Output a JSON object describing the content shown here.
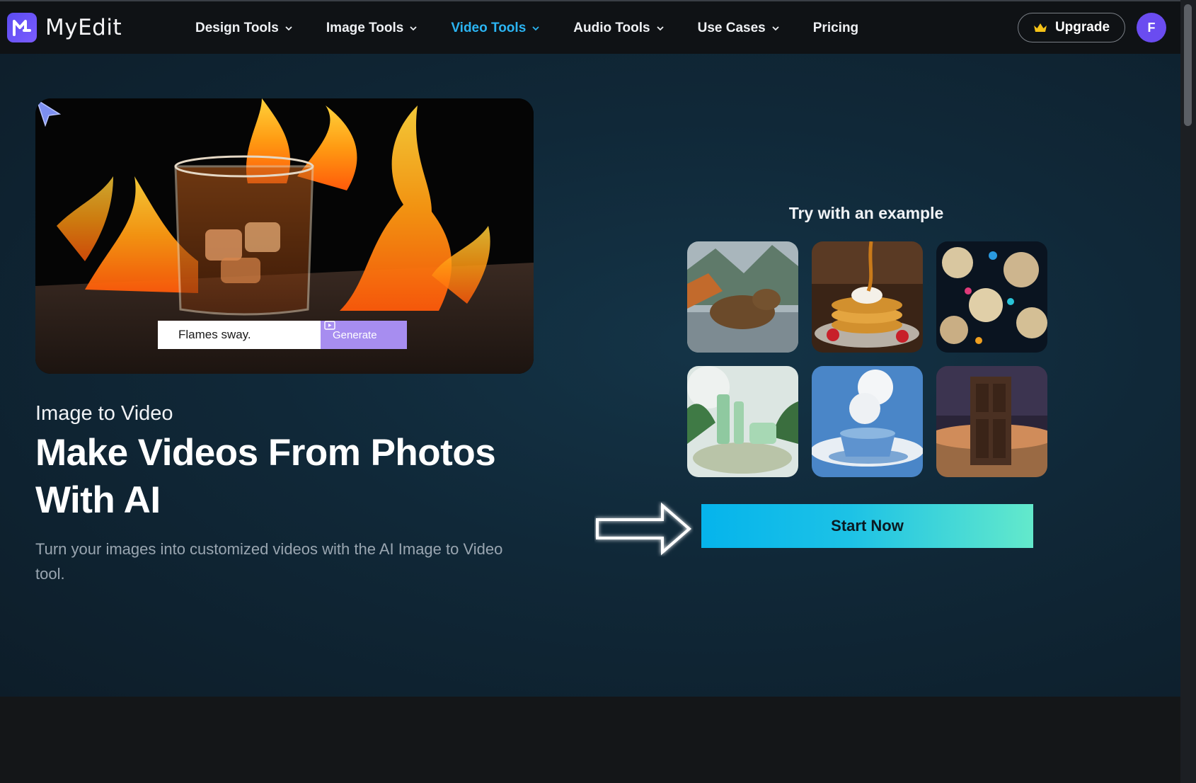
{
  "brand": {
    "name": "MyEdit"
  },
  "nav": {
    "items": [
      {
        "label": "Design Tools",
        "has_dropdown": true,
        "active": false
      },
      {
        "label": "Image Tools",
        "has_dropdown": true,
        "active": false
      },
      {
        "label": "Video Tools",
        "has_dropdown": true,
        "active": true
      },
      {
        "label": "Audio Tools",
        "has_dropdown": true,
        "active": false
      },
      {
        "label": "Use Cases",
        "has_dropdown": true,
        "active": false
      },
      {
        "label": "Pricing",
        "has_dropdown": false,
        "active": false
      }
    ],
    "upgrade_label": "Upgrade",
    "avatar_initial": "F"
  },
  "hero": {
    "demo_prompt": "Flames sway.",
    "demo_generate_label": "Generate",
    "eyebrow": "Image to Video",
    "headline": "Make Videos From Photos With AI",
    "subtext": "Turn your images into customized videos with the AI Image to Video tool."
  },
  "examples": {
    "title": "Try with an example",
    "items": [
      {
        "icon": "capybara-in-water-image"
      },
      {
        "icon": "pancakes-with-syrup-image"
      },
      {
        "icon": "coral-reef-fish-image"
      },
      {
        "icon": "skincare-bottles-image"
      },
      {
        "icon": "coffee-cup-clouds-image"
      },
      {
        "icon": "door-in-desert-image"
      }
    ]
  },
  "cta": {
    "start_label": "Start Now"
  },
  "colors": {
    "accent_active_nav": "#2bb4f2",
    "brand_purple": "#6a4cf0",
    "cta_gradient_start": "#05b4ec",
    "cta_gradient_end": "#63e9cb",
    "generate_button": "#a78df0"
  }
}
